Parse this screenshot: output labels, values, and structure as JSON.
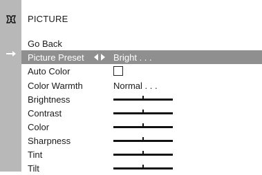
{
  "menu": {
    "title": "PICTURE",
    "go_back": "Go Back",
    "items": [
      {
        "label": "Picture Preset",
        "value": "Bright . . ."
      },
      {
        "label": "Auto Color",
        "checked": false
      },
      {
        "label": "Color Warmth",
        "value": "Normal . . ."
      },
      {
        "label": "Brightness",
        "level": 0.5
      },
      {
        "label": "Contrast",
        "level": 0.5
      },
      {
        "label": "Color",
        "level": 0.5
      },
      {
        "label": "Sharpness",
        "level": 0.5
      },
      {
        "label": "Tint",
        "level": 0.5
      },
      {
        "label": "Tilt",
        "level": 0.5
      }
    ]
  },
  "icons": {
    "menu_icon": "picture-menu-icon",
    "selection_arrow": "right-arrow-icon",
    "left_right": "left-right-arrows-icon"
  },
  "colors": {
    "sidebar": "#b8b8b8",
    "selected_row": "#8f8f8f"
  }
}
